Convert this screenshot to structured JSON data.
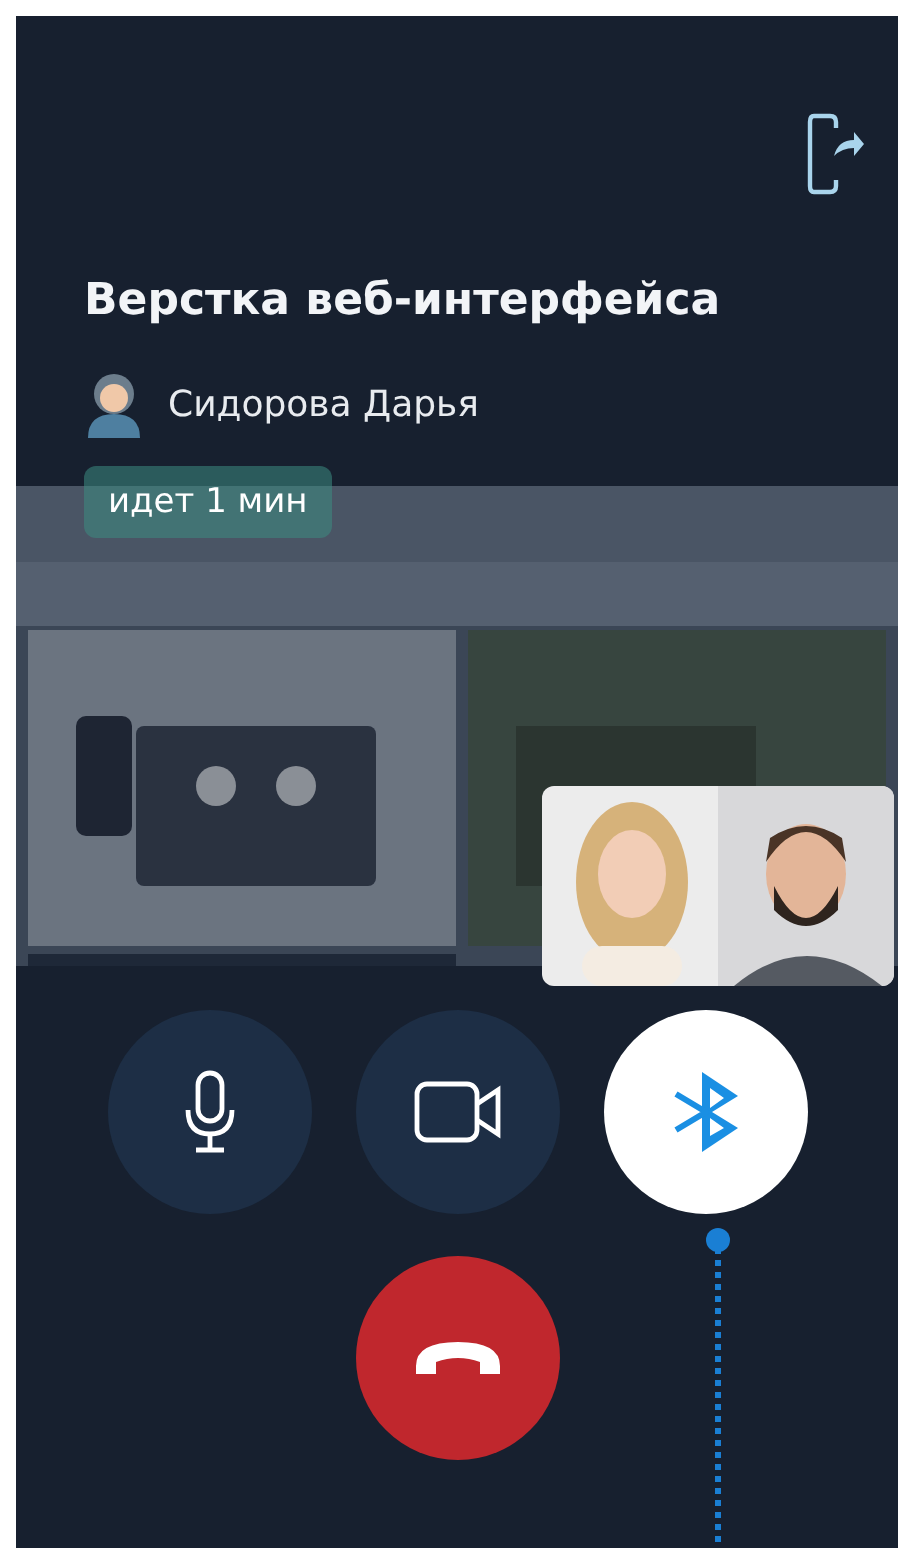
{
  "call": {
    "title": "Верстка веб-интерфейса",
    "organizer": "Сидорова Дарья",
    "status": "идет 1 мин"
  },
  "controls": [
    {
      "kind": "microphone",
      "selected": false
    },
    {
      "kind": "camera",
      "selected": false
    },
    {
      "kind": "bluetooth",
      "selected": true
    }
  ],
  "hangup": {
    "kind": "end-call"
  }
}
